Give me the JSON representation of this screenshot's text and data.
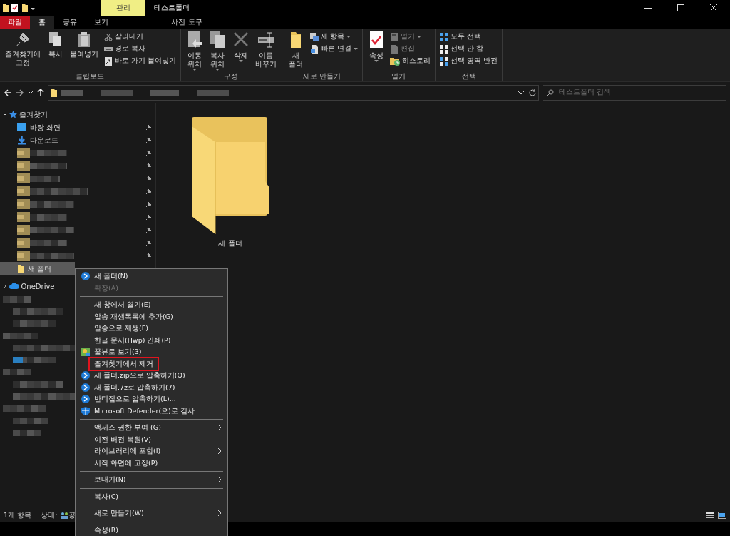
{
  "title_bar": {
    "context_tab": "관리",
    "title": "테스트폴더"
  },
  "ribbon_tabs": [
    {
      "label": "파일",
      "kind": "file",
      "selected": false
    },
    {
      "label": "홈",
      "kind": "tab",
      "selected": true
    },
    {
      "label": "공유",
      "kind": "tab",
      "selected": false
    },
    {
      "label": "보기",
      "kind": "tab",
      "selected": false
    },
    {
      "label": "사진 도구",
      "kind": "context",
      "selected": false
    }
  ],
  "ribbon_groups": [
    {
      "label": "클립보드",
      "items": [
        {
          "label": "즐겨찾기에\n고정",
          "kind": "large",
          "dropdown": false,
          "disabled": false
        },
        {
          "label": "복사",
          "kind": "large",
          "dropdown": false,
          "disabled": false
        },
        {
          "label": "붙여넣기",
          "kind": "large",
          "dropdown": false,
          "disabled": false
        },
        {
          "label": "잘라내기",
          "kind": "small",
          "dropdown": false,
          "disabled": false
        },
        {
          "label": "경로 복사",
          "kind": "small",
          "dropdown": false,
          "disabled": false
        },
        {
          "label": "바로 가기 붙여넣기",
          "kind": "small",
          "dropdown": false,
          "disabled": false
        }
      ]
    },
    {
      "label": "구성",
      "items": [
        {
          "label": "이동\n위치",
          "kind": "large",
          "dropdown": true,
          "disabled": false
        },
        {
          "label": "복사\n위치",
          "kind": "large",
          "dropdown": true,
          "disabled": false
        },
        {
          "label": "삭제",
          "kind": "large",
          "dropdown": true,
          "disabled": false
        },
        {
          "label": "이름\n바꾸기",
          "kind": "large",
          "dropdown": false,
          "disabled": false
        }
      ]
    },
    {
      "label": "새로 만들기",
      "items": [
        {
          "label": "새\n폴더",
          "kind": "large",
          "dropdown": false,
          "disabled": false
        },
        {
          "label": "새 항목",
          "kind": "small",
          "dropdown": true,
          "disabled": false
        },
        {
          "label": "빠른 연결",
          "kind": "small",
          "dropdown": true,
          "disabled": false
        }
      ]
    },
    {
      "label": "열기",
      "items": [
        {
          "label": "속성",
          "kind": "large",
          "dropdown": true,
          "disabled": false
        },
        {
          "label": "열기",
          "kind": "small",
          "dropdown": true,
          "disabled": true
        },
        {
          "label": "편집",
          "kind": "small",
          "dropdown": false,
          "disabled": true
        },
        {
          "label": "히스토리",
          "kind": "small",
          "dropdown": false,
          "disabled": false
        }
      ]
    },
    {
      "label": "선택",
      "items": [
        {
          "label": "모두 선택",
          "kind": "small",
          "dropdown": false,
          "disabled": false
        },
        {
          "label": "선택 안 함",
          "kind": "small",
          "dropdown": false,
          "disabled": false
        },
        {
          "label": "선택 영역 반전",
          "kind": "small",
          "dropdown": false,
          "disabled": false
        }
      ]
    }
  ],
  "address_bar": {
    "search_placeholder": "테스트폴더 검색"
  },
  "sidebar": {
    "favorites": {
      "label": "즐겨찾기",
      "expanded": true,
      "children": [
        {
          "kind": "item",
          "label": "바탕 화면",
          "pinned": true,
          "selected": false
        },
        {
          "kind": "item",
          "label": "다운로드",
          "pinned": true,
          "selected": false
        },
        {
          "kind": "redacted",
          "pinned": true
        },
        {
          "kind": "redacted",
          "pinned": true
        },
        {
          "kind": "redacted",
          "pinned": true
        },
        {
          "kind": "redacted",
          "pinned": true
        },
        {
          "kind": "redacted",
          "pinned": true
        },
        {
          "kind": "redacted",
          "pinned": true
        },
        {
          "kind": "redacted",
          "pinned": true
        },
        {
          "kind": "redacted",
          "pinned": true
        },
        {
          "kind": "redacted",
          "pinned": true
        },
        {
          "kind": "item",
          "label": "새 폴더",
          "pinned": false,
          "selected": true
        }
      ]
    },
    "onedrive": {
      "label": "OneDrive",
      "expanded": false
    },
    "other": [
      {
        "kind": "redacted"
      },
      {
        "kind": "redacted"
      },
      {
        "kind": "redacted"
      },
      {
        "kind": "redacted"
      },
      {
        "kind": "redacted"
      },
      {
        "kind": "redacted"
      },
      {
        "kind": "redacted"
      },
      {
        "kind": "redacted"
      },
      {
        "kind": "redacted"
      },
      {
        "kind": "redacted"
      },
      {
        "kind": "redacted"
      },
      {
        "kind": "redacted"
      }
    ]
  },
  "content": {
    "items": [
      {
        "label": "새 폴더"
      }
    ]
  },
  "context_menu": [
    {
      "kind": "item",
      "label": "새 폴더(N)",
      "disabled": false,
      "submenu": false,
      "annotated": false
    },
    {
      "kind": "item",
      "label": "확장(A)",
      "disabled": true,
      "submenu": false,
      "annotated": false
    },
    {
      "kind": "separator"
    },
    {
      "kind": "item",
      "label": "새 창에서 열기(E)",
      "disabled": false,
      "submenu": false,
      "annotated": false
    },
    {
      "kind": "item",
      "label": "알송 재생목록에 추가(G)",
      "disabled": false,
      "submenu": false,
      "annotated": false
    },
    {
      "kind": "item",
      "label": "알송으로 재생(F)",
      "disabled": false,
      "submenu": false,
      "annotated": false
    },
    {
      "kind": "item",
      "label": "한글 문서(Hwp) 인쇄(P)",
      "disabled": false,
      "submenu": false,
      "annotated": false
    },
    {
      "kind": "item",
      "label": "꿀뷰로 보기(3)",
      "disabled": false,
      "submenu": false,
      "annotated": false
    },
    {
      "kind": "item",
      "label": "즐겨찾기에서 제거",
      "disabled": false,
      "submenu": false,
      "annotated": true
    },
    {
      "kind": "item",
      "label": "새 폴더.zip으로 압축하기(Q)",
      "disabled": false,
      "submenu": false,
      "annotated": false
    },
    {
      "kind": "item",
      "label": "새 폴더.7z로 압축하기(7)",
      "disabled": false,
      "submenu": false,
      "annotated": false
    },
    {
      "kind": "item",
      "label": "반디집으로 압축하기(L)...",
      "disabled": false,
      "submenu": false,
      "annotated": false
    },
    {
      "kind": "item",
      "label": "Microsoft Defender(으)로 검사...",
      "disabled": false,
      "submenu": false,
      "annotated": false
    },
    {
      "kind": "separator"
    },
    {
      "kind": "item",
      "label": "액세스 권한 부여 (G)",
      "disabled": false,
      "submenu": true,
      "annotated": false
    },
    {
      "kind": "item",
      "label": "이전 버전 복원(V)",
      "disabled": false,
      "submenu": false,
      "annotated": false
    },
    {
      "kind": "item",
      "label": "라이브러리에 포함(I)",
      "disabled": false,
      "submenu": true,
      "annotated": false
    },
    {
      "kind": "item",
      "label": "시작 화면에 고정(P)",
      "disabled": false,
      "submenu": false,
      "annotated": false
    },
    {
      "kind": "separator"
    },
    {
      "kind": "item",
      "label": "보내기(N)",
      "disabled": false,
      "submenu": true,
      "annotated": false
    },
    {
      "kind": "separator"
    },
    {
      "kind": "item",
      "label": "복사(C)",
      "disabled": false,
      "submenu": false,
      "annotated": false
    },
    {
      "kind": "separator"
    },
    {
      "kind": "item",
      "label": "새로 만들기(W)",
      "disabled": false,
      "submenu": true,
      "annotated": false
    },
    {
      "kind": "separator"
    },
    {
      "kind": "item",
      "label": "속성(R)",
      "disabled": false,
      "submenu": false,
      "annotated": false
    }
  ],
  "status_bar": {
    "count": "1개 항목",
    "divider": "|",
    "status_label": "상태:",
    "status_value": "공"
  }
}
